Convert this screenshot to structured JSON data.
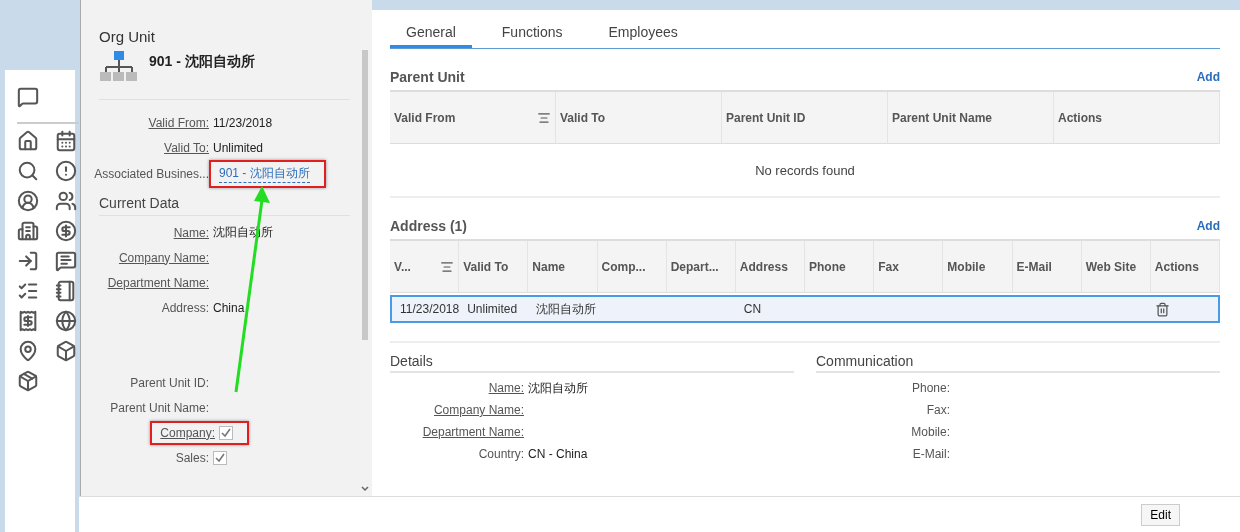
{
  "org_panel": {
    "title": "Org Unit",
    "unit_name": "901 - 沈阳自动所",
    "header_fields": [
      {
        "label": "Valid From:",
        "underlined": true,
        "kind": "text",
        "value": "11/23/2018"
      },
      {
        "label": "Valid To:",
        "underlined": true,
        "kind": "text",
        "value": "Unlimited"
      },
      {
        "label": "Associated Busines...",
        "underlined": false,
        "kind": "link",
        "value": "901 - 沈阳自动所",
        "highlighted": true
      }
    ],
    "current_data": {
      "title": "Current Data",
      "fields": [
        {
          "label": "Name:",
          "underlined": true,
          "kind": "text",
          "value": "沈阳自动所"
        },
        {
          "label": "Company Name:",
          "underlined": true,
          "kind": "text"
        },
        {
          "label": "Department Name:",
          "underlined": true,
          "kind": "text"
        },
        {
          "label": "Address:",
          "underlined": false,
          "kind": "text",
          "value": "China"
        }
      ]
    },
    "parent_fields": [
      {
        "label": "Parent Unit ID:",
        "underlined": false,
        "kind": "text"
      },
      {
        "label": "Parent Unit Name:",
        "underlined": false,
        "kind": "text"
      },
      {
        "label": "Company:",
        "underlined": true,
        "kind": "checkbox",
        "checked": true,
        "highlighted": true
      },
      {
        "label": "Sales:",
        "underlined": false,
        "kind": "checkbox",
        "checked": true
      }
    ]
  },
  "tabs": [
    {
      "label": "General",
      "selected": true
    },
    {
      "label": "Functions",
      "selected": false
    },
    {
      "label": "Employees",
      "selected": false
    }
  ],
  "parent_unit": {
    "title": "Parent Unit",
    "add": "Add",
    "columns": [
      {
        "label": "Valid From",
        "sortable": true
      },
      {
        "label": "Valid To",
        "sortable": false
      },
      {
        "label": "Parent Unit ID",
        "sortable": false
      },
      {
        "label": "Parent Unit Name",
        "sortable": false
      },
      {
        "label": "Actions",
        "sortable": false
      }
    ],
    "empty_text": "No records found"
  },
  "address": {
    "title": "Address (1)",
    "add": "Add",
    "columns": [
      {
        "label": "V...",
        "sortable": true
      },
      {
        "label": "Valid To",
        "sortable": false
      },
      {
        "label": "Name",
        "sortable": false
      },
      {
        "label": "Comp...",
        "sortable": false
      },
      {
        "label": "Depart...",
        "sortable": false
      },
      {
        "label": "Address",
        "sortable": false
      },
      {
        "label": "Phone",
        "sortable": false
      },
      {
        "label": "Fax",
        "sortable": false
      },
      {
        "label": "Mobile",
        "sortable": false
      },
      {
        "label": "E-Mail",
        "sortable": false
      },
      {
        "label": "Web Site",
        "sortable": false
      },
      {
        "label": "Actions",
        "sortable": false
      }
    ],
    "rows": [
      {
        "selected": true,
        "valid_from": "11/23/2018",
        "valid_to": "Unlimited",
        "name": "沈阳自动所",
        "address": "CN"
      }
    ]
  },
  "details": {
    "title": "Details",
    "fields": [
      {
        "label": "Name:",
        "underlined": true,
        "value": "沈阳自动所"
      },
      {
        "label": "Company Name:",
        "underlined": true
      },
      {
        "label": "Department Name:",
        "underlined": true
      },
      {
        "label": "Country:",
        "underlined": false,
        "value": "CN - China"
      }
    ]
  },
  "communication": {
    "title": "Communication",
    "fields": [
      {
        "label": "Phone:"
      },
      {
        "label": "Fax:"
      },
      {
        "label": "Mobile:"
      },
      {
        "label": "E-Mail:"
      }
    ]
  },
  "footer": {
    "buttons": [
      "Edit"
    ]
  }
}
